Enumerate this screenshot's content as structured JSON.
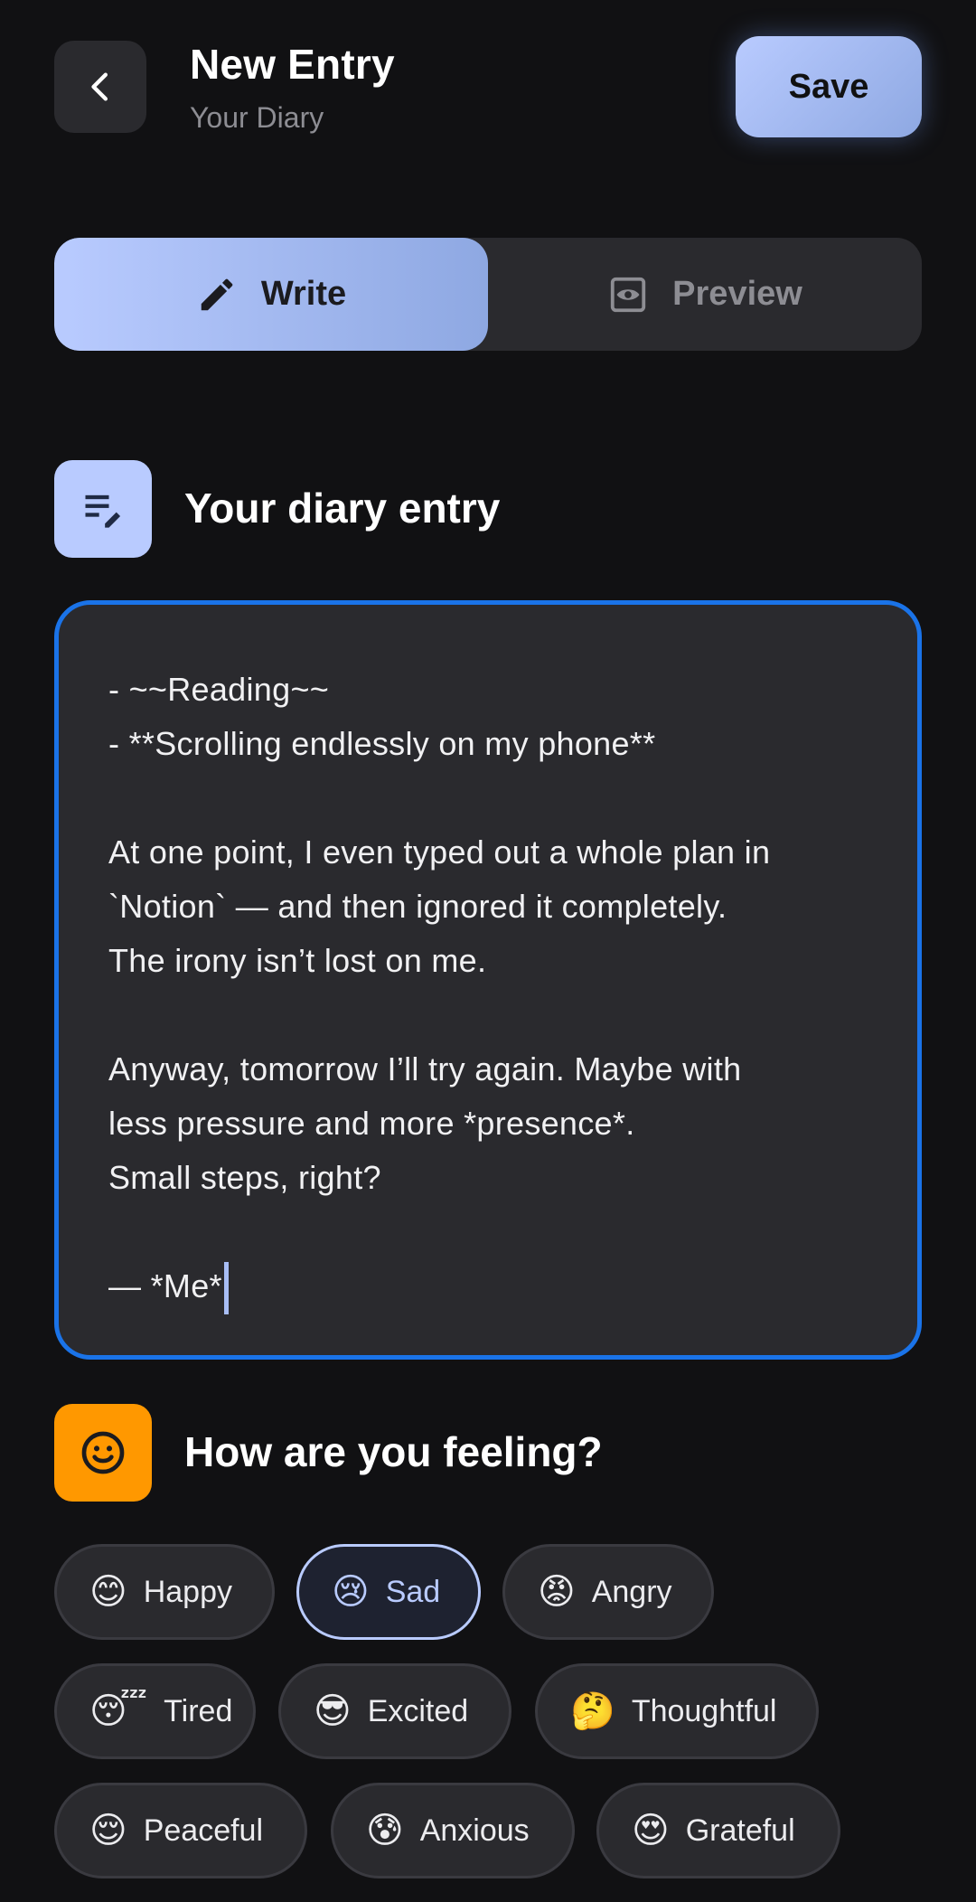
{
  "header": {
    "title": "New Entry",
    "subtitle": "Your Diary",
    "save_label": "Save"
  },
  "tabs": [
    {
      "label": "Write",
      "icon": "pencil-icon",
      "active": true
    },
    {
      "label": "Preview",
      "icon": "eye-icon",
      "active": false
    }
  ],
  "entry_section": {
    "title": "Your diary entry",
    "icon": "edit-note-icon",
    "icon_bg": "#b9cbff"
  },
  "editor": {
    "lines": [
      "- ~~Reading~~",
      "- **Scrolling endlessly on my phone**",
      "",
      "At one point, I even typed out a whole plan in",
      "`Notion` — and then ignored it completely.",
      "The irony isn’t lost on me.",
      "",
      "Anyway, tomorrow I’ll try again. Maybe with",
      "less pressure and more *presence*.",
      "Small steps, right?",
      "",
      "— *Me*"
    ],
    "border_color": "#1a73e8"
  },
  "mood_section": {
    "title": "How are you feeling?",
    "icon": "smiley-icon",
    "icon_bg": "#ff9800"
  },
  "moods": [
    {
      "emoji": "😊",
      "label": "Happy",
      "selected": false
    },
    {
      "emoji": "😢",
      "label": "Sad",
      "selected": true
    },
    {
      "emoji": "😡",
      "label": "Angry",
      "selected": false
    },
    {
      "emoji": "😴",
      "label": "Tired",
      "selected": false
    },
    {
      "emoji": "😎",
      "label": "Excited",
      "selected": false
    },
    {
      "emoji": "🤔",
      "label": "Thoughtful",
      "selected": false
    },
    {
      "emoji": "😌",
      "label": "Peaceful",
      "selected": false
    },
    {
      "emoji": "😰",
      "label": "Anxious",
      "selected": false
    },
    {
      "emoji": "😍",
      "label": "Grateful",
      "selected": false
    }
  ],
  "colors": {
    "accent": "#b9cbff",
    "background": "#111113",
    "surface": "#2a2a2e"
  }
}
